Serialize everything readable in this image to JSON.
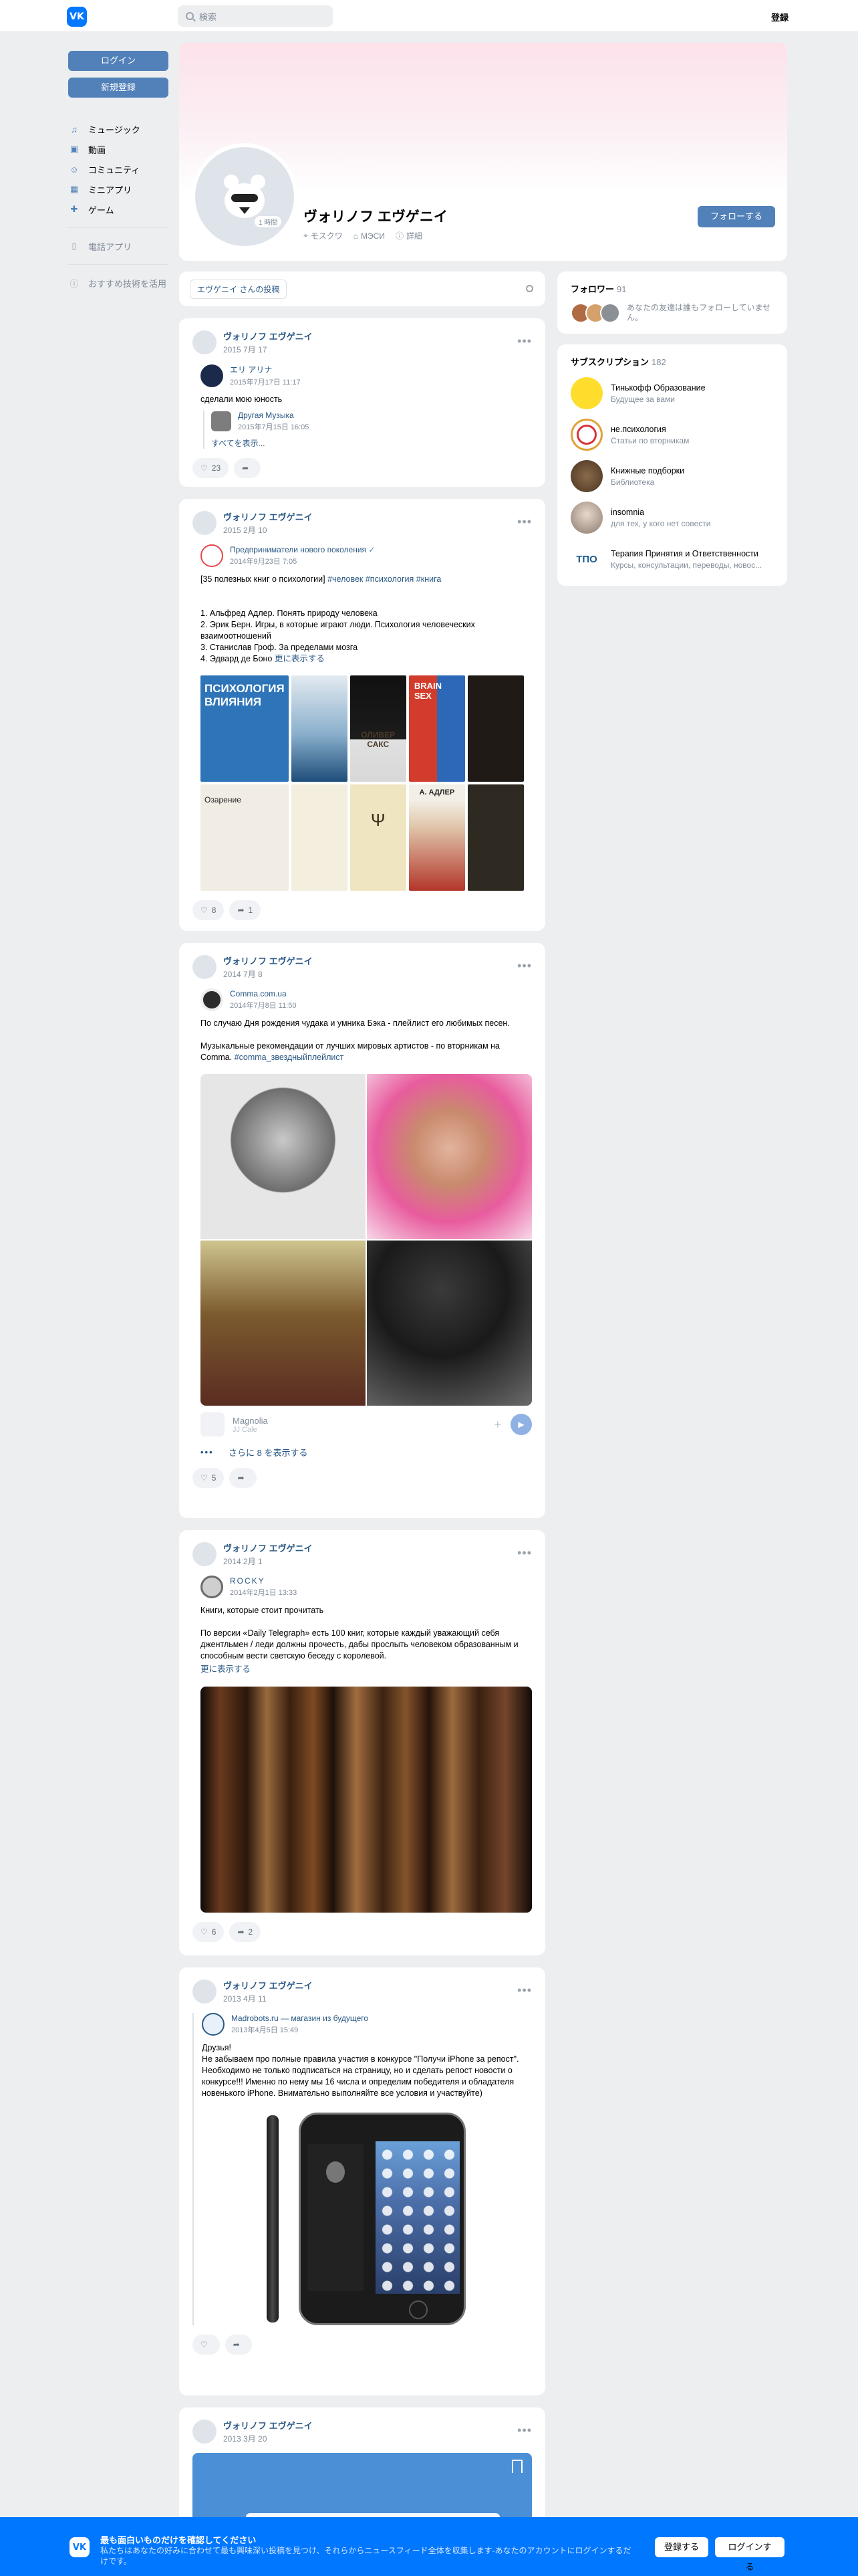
{
  "header": {
    "logo": "VK",
    "search_placeholder": "検索",
    "register": "登録"
  },
  "sidebar": {
    "login": "ログイン",
    "signup": "新規登録",
    "items": [
      {
        "label": "ミュージック",
        "icon": "music-icon"
      },
      {
        "label": "動画",
        "icon": "video-icon"
      },
      {
        "label": "コミュニティ",
        "icon": "community-icon"
      },
      {
        "label": "ミニアプリ",
        "icon": "apps-icon"
      },
      {
        "label": "ゲーム",
        "icon": "game-icon"
      }
    ],
    "phone_apps": "電話アプリ",
    "recommend": "おすすめ技術を活用"
  },
  "profile": {
    "name": "ヴォリノフ エヴゲニイ",
    "online": "1 時間",
    "city": "モスクワ",
    "university": "МЭСИ",
    "details": "詳細",
    "follow": "フォローする"
  },
  "wall": {
    "tab": "エヴゲニイ さんの投稿"
  },
  "posts": [
    {
      "author": "ヴォリノフ エヴゲニイ",
      "date": "2015 7月 17",
      "repost_name": "エリ アリナ",
      "repost_date": "2015年7月17日 11:17",
      "text": "сделали мою юность",
      "nested_name": "Другая Музыка",
      "nested_date": "2015年7月15日 16:05",
      "show_all": "すべてを表示...",
      "likes": "23",
      "shares": ""
    },
    {
      "author": "ヴォリノフ エヴゲニイ",
      "date": "2015 2月 10",
      "repost_name": "Предприниматели нового поколения",
      "repost_date": "2014年9月23日 7:05",
      "text_head": "[35 полезных книг о психологии] ",
      "tags": "#человек #психология #книга",
      "text_body": "1. Альфред Адлер. Понять природу человека\n2. Эрик Берн. Игры, в которые играют люди. Психология человеческих взаимоотношений\n3. Станислав Гроф. За пределами мозга\n4. Эдвард де Боно ",
      "more": "更に表示する",
      "book_texts": [
        "ПСИХОЛОГИЯ ВЛИЯНИЯ",
        "",
        "ОЛИВЕР САКС",
        "BRAIN SEX",
        "",
        "",
        "Озарение",
        "",
        "А. АДЛЕР",
        ""
      ],
      "likes": "8",
      "shares": "1"
    },
    {
      "author": "ヴォリノフ エヴゲニイ",
      "date": "2014 7月 8",
      "repost_name": "Comma.com.ua",
      "repost_date": "2014年7月8日 11:50",
      "text": "По случаю Дня рождения чудака и умника Бэка - плейлист его любимых песен.\n\nМузыкальные рекомендации от лучших мировых артистов - по вторникам на Comma. ",
      "tags": "#comma_звездныйплейлист",
      "audio_title": "Magnolia",
      "audio_artist": "JJ Cale",
      "show_more": "さらに 8 を表示する",
      "likes": "5",
      "shares": ""
    },
    {
      "author": "ヴォリノフ エヴゲニイ",
      "date": "2014 2月 1",
      "repost_name": "ROCKY",
      "repost_date": "2014年2月1日 13:33",
      "text": "Книги, которые стоит прочитать\n\nПо версии «Daily Telegraph» есть 100 книг, которые каждый уважающий себя джентльмен / леди должны прочесть, дабы прослыть человеком образованным и способным вести светскую беседу с королевой.",
      "more": "更に表示する",
      "likes": "6",
      "shares": "2"
    },
    {
      "author": "ヴォリノフ エヴゲニイ",
      "date": "2013 4月 11",
      "repost_name": "Madrobots.ru — магазин из будущего",
      "repost_date": "2013年4月5日 15:49",
      "text": "Друзья!\nНе забываем про полные правила участия в конкурсе \"Получи iPhone за репост\".\nНеобходимо не только подписаться на страницу, но и сделать репост новости о конкурсе!!! Именно по нему мы 16 числа и определим победителя и обладателя новенького iPhone. Внимательно выполняйте все условия и участвуйте)",
      "likes": "",
      "shares": ""
    },
    {
      "author": "ヴォリノフ エヴゲニイ",
      "date": "2013 3月 20"
    }
  ],
  "followers": {
    "title": "フォロワー",
    "count": "91",
    "text": "あなたの友達は誰もフォローしていません。"
  },
  "subscriptions": {
    "title": "サブスクリプション",
    "count": "182",
    "items": [
      {
        "name": "Тинькофф Образование",
        "desc": "Будущее за вами"
      },
      {
        "name": "не.психология",
        "desc": "Статьи по вторникам"
      },
      {
        "name": "Книжные подборки",
        "desc": "Библиотека"
      },
      {
        "name": "insomnia",
        "desc": "для тех, у кого нет совести"
      },
      {
        "name": "Терапия Принятия и Ответственности",
        "desc": "Курсы, консультации, переводы, новос...",
        "logo": "ТПО"
      }
    ]
  },
  "banner": {
    "title": "最も面白いものだけを確認してください",
    "text": "私たちはあなたの好みに合わせて最も興味深い投稿を見つけ、それらからニュースフィード全体を収集します-あなたのアカウントにログインするだけです。",
    "register": "登録する",
    "login": "ログインする"
  },
  "colors": {
    "accent": "#5181b8",
    "brand": "#0077ff",
    "link": "#2a5885"
  }
}
